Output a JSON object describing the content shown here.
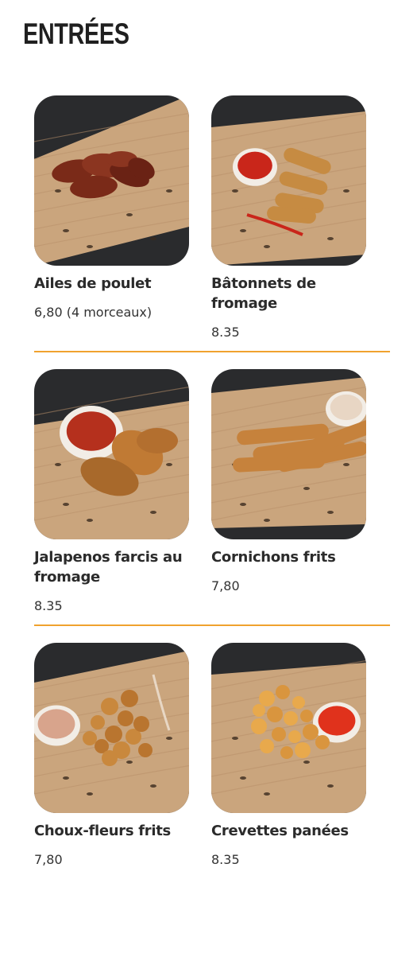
{
  "page": {
    "title": "ENTRÉES"
  },
  "colors": {
    "accent": "#f0a22e",
    "title": "#1f1f1f",
    "text": "#2b2b2b",
    "board": "#caa57d",
    "backdrop": "#2a2b2d"
  },
  "menu": {
    "items": [
      {
        "name": "Ailes de poulet",
        "price": "6,80 (4 morceaux)",
        "image": "chicken-wings-photo",
        "food": "wings"
      },
      {
        "name": "Bâtonnets de fromage",
        "price": "8.35",
        "image": "cheese-sticks-photo",
        "food": "sticks"
      },
      {
        "name": "Jalapenos farcis au fromage",
        "price": "8.35",
        "image": "stuffed-jalapenos-photo",
        "food": "jalapenos"
      },
      {
        "name": "Cornichons frits",
        "price": "7,80",
        "image": "fried-pickles-photo",
        "food": "pickles"
      },
      {
        "name": "Choux-fleurs frits",
        "price": "7,80",
        "image": "fried-cauliflower-photo",
        "food": "cauliflower"
      },
      {
        "name": "Crevettes panées",
        "price": "8.35",
        "image": "breaded-shrimp-photo",
        "food": "shrimp"
      }
    ]
  }
}
